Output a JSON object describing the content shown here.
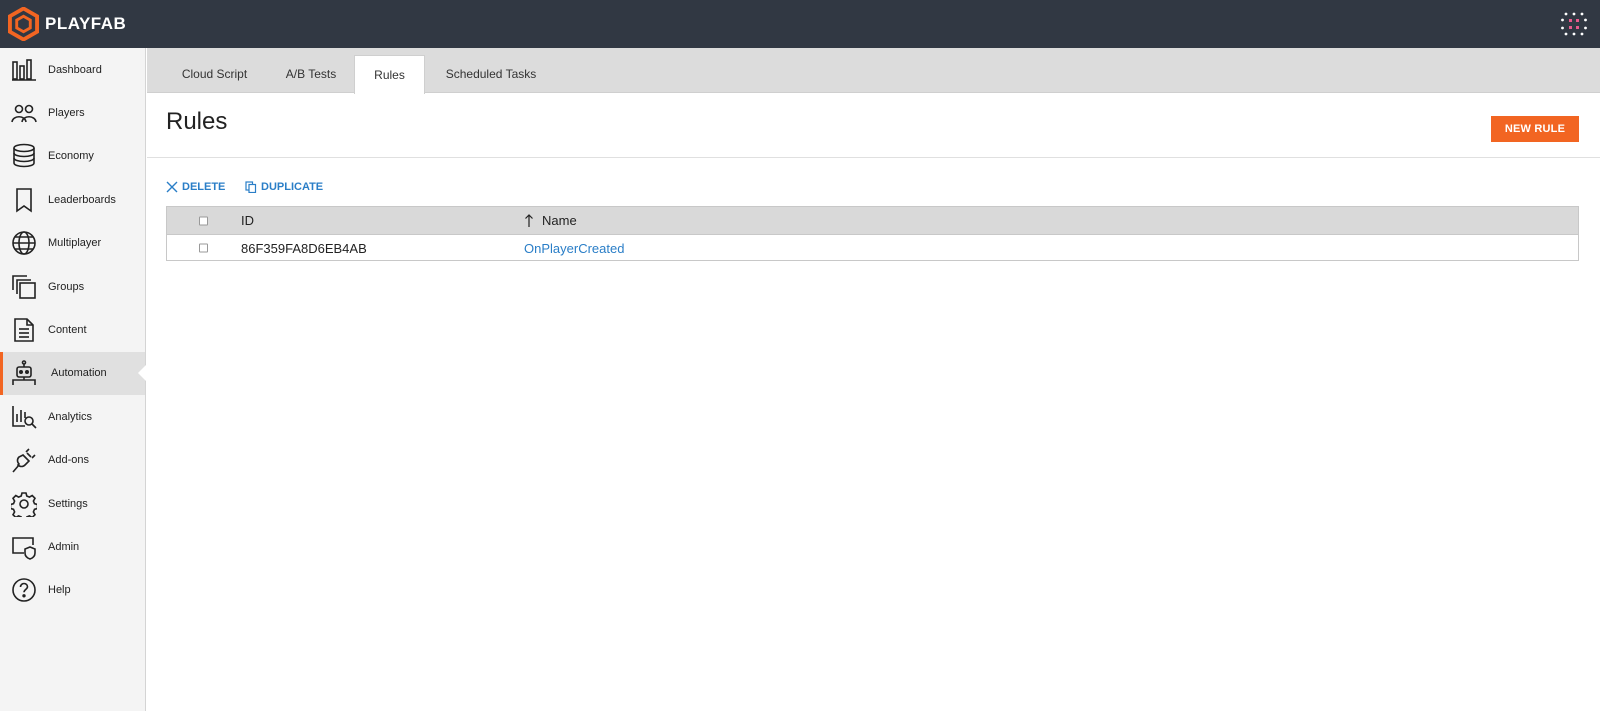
{
  "brand": {
    "name": "PLAYFAB",
    "accent": "#f26522",
    "topbar_bg": "#313843",
    "link": "#2a7ec7"
  },
  "sidebar": {
    "items": [
      {
        "label": "Dashboard",
        "icon": "dashboard-icon"
      },
      {
        "label": "Players",
        "icon": "players-icon"
      },
      {
        "label": "Economy",
        "icon": "economy-icon"
      },
      {
        "label": "Leaderboards",
        "icon": "leaderboards-icon"
      },
      {
        "label": "Multiplayer",
        "icon": "globe-icon"
      },
      {
        "label": "Groups",
        "icon": "groups-icon"
      },
      {
        "label": "Content",
        "icon": "content-icon"
      },
      {
        "label": "Automation",
        "icon": "robot-icon",
        "active": true
      },
      {
        "label": "Analytics",
        "icon": "analytics-icon"
      },
      {
        "label": "Add-ons",
        "icon": "plug-icon"
      },
      {
        "label": "Settings",
        "icon": "gear-icon"
      },
      {
        "label": "Admin",
        "icon": "admin-shield-icon"
      },
      {
        "label": "Help",
        "icon": "help-icon"
      }
    ]
  },
  "tabs": [
    {
      "label": "Cloud Script"
    },
    {
      "label": "A/B Tests"
    },
    {
      "label": "Rules",
      "active": true
    },
    {
      "label": "Scheduled Tasks"
    }
  ],
  "page": {
    "title": "Rules",
    "new_button": "NEW RULE"
  },
  "actions": {
    "delete": "DELETE",
    "duplicate": "DUPLICATE"
  },
  "table": {
    "columns": {
      "id": "ID",
      "name": "Name"
    },
    "rows": [
      {
        "id": "86F359FA8D6EB4AB",
        "name": "OnPlayerCreated"
      }
    ]
  }
}
